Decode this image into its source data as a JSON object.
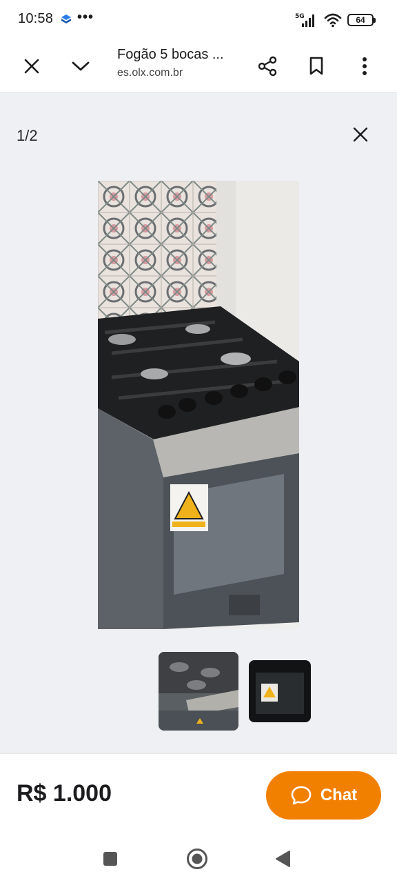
{
  "status_bar": {
    "time": "10:58",
    "dots": "•••",
    "network": "5G",
    "battery": "64"
  },
  "browser": {
    "title": "Fogão 5 bocas ...",
    "url": "es.olx.com.br",
    "icons": [
      "close-icon",
      "chevron-down-icon",
      "share-icon",
      "bookmark-icon",
      "more-vert-icon"
    ]
  },
  "gallery": {
    "counter": "1/2",
    "photo_subject": "stove",
    "thumbnails": 2
  },
  "footer": {
    "price": "R$ 1.000",
    "chat_label": "Chat",
    "accent_color": "#f28000"
  },
  "nav": {
    "icons": [
      "recents-square-icon",
      "home-circle-icon",
      "back-triangle-icon"
    ]
  }
}
